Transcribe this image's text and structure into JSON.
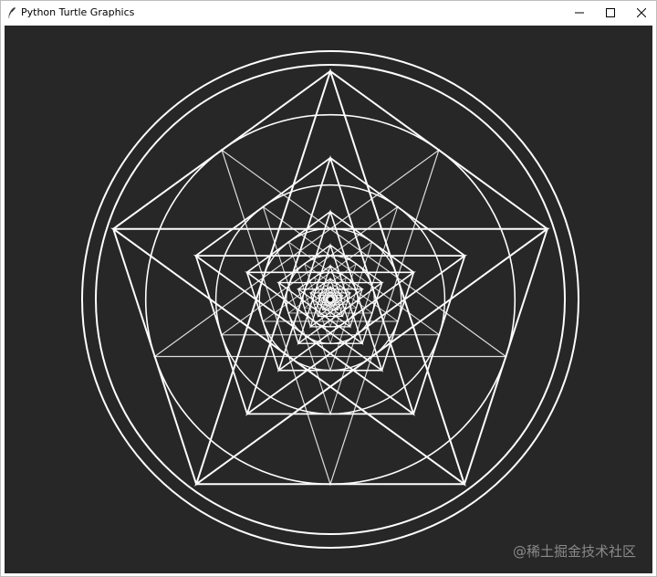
{
  "window": {
    "title": "Python Turtle Graphics",
    "controls": {
      "minimize": "minimize-icon",
      "maximize": "maximize-icon",
      "close": "close-icon"
    }
  },
  "canvas": {
    "background": "#272727",
    "stroke": "#ffffff"
  },
  "watermark": {
    "text": "@稀土掘金技术社区"
  }
}
